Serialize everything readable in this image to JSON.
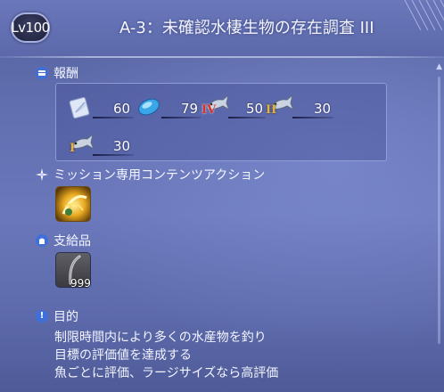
{
  "window": {
    "level_label": "Lv100",
    "title": "A-3：未確認水棲生物の存在調査 III"
  },
  "rewards": {
    "label": "報酬",
    "items": [
      {
        "icon": "feather-card-icon",
        "quantity": "60"
      },
      {
        "icon": "blue-crystal-icon",
        "quantity": "79"
      },
      {
        "icon": "fish-tier-iv-icon",
        "tier": "IV",
        "quantity": "50"
      },
      {
        "icon": "fish-tier-ii-icon",
        "tier": "II",
        "quantity": "30"
      },
      {
        "icon": "fish-tier-i-icon",
        "tier": "I",
        "quantity": "30"
      }
    ]
  },
  "mission_action": {
    "label": "ミッション専用コンテンツアクション",
    "icon": "mission-action-icon"
  },
  "supplies": {
    "label": "支給品",
    "item": {
      "icon": "fishing-tackle-icon",
      "quantity": "999"
    }
  },
  "objective": {
    "label": "目的",
    "lines": [
      "制限時間内により多くの水産物を釣り",
      "目標の評価値を達成する",
      "魚ごとに評価、ラージサイズなら高評価"
    ]
  },
  "colors": {
    "panel_bg": "#6270b2",
    "accent_gold": "#d9b24a",
    "tier_red": "#c8282a"
  }
}
